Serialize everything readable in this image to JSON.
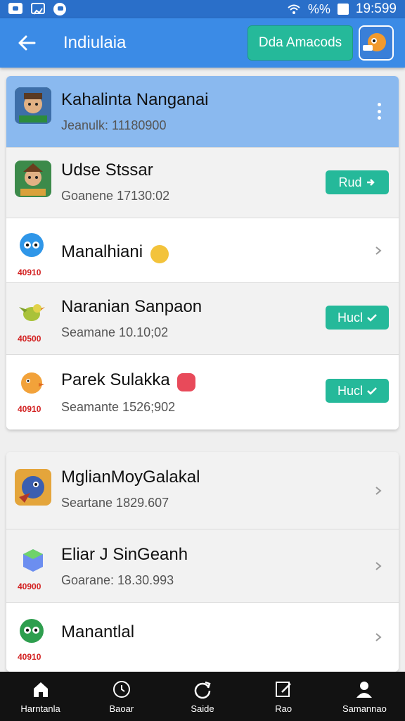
{
  "status_bar": {
    "time": "19:599",
    "signal": "%%"
  },
  "app_bar": {
    "title": "Indiulaia",
    "action_label": "Dda Amacods"
  },
  "list_top": [
    {
      "title": "Kahalinta Nanganai",
      "subtitle": "Jeanulk: 11180900",
      "trailing": "more"
    },
    {
      "title": "Udse Stssar",
      "subtitle": "Goanene 17130:02",
      "trailing": "pill",
      "pill_label": "Rud"
    },
    {
      "title": "Manalhiani",
      "badge": "40910",
      "trailing": "chevron"
    },
    {
      "title": "Naranian Sanpaon",
      "subtitle": "Seamane 10.10;02",
      "badge": "40500",
      "trailing": "pill",
      "pill_label": "Hucl"
    },
    {
      "title": "Parek Sulakka",
      "subtitle": "Seamante 1526;902",
      "badge": "40910",
      "trailing": "pill",
      "pill_label": "Hucl"
    }
  ],
  "list_bottom": [
    {
      "title": "MglianMoyGalakal",
      "subtitle": "Seartane 1829.607",
      "trailing": "chevron"
    },
    {
      "title": "Eliar J SinGeanh",
      "subtitle": "Goarane: 18.30.993",
      "badge": "40900",
      "trailing": "chevron"
    },
    {
      "title": "Manantlal",
      "badge": "40910",
      "trailing": "chevron"
    }
  ],
  "bottom_nav": [
    {
      "label": "Harntanla",
      "icon": "home-icon"
    },
    {
      "label": "Baoar",
      "icon": "clock-icon"
    },
    {
      "label": "Saide",
      "icon": "refresh-icon"
    },
    {
      "label": "Rao",
      "icon": "edit-icon"
    },
    {
      "label": "Samannao",
      "icon": "person-icon"
    }
  ],
  "colors": {
    "status_bar": "#2a6fc9",
    "app_bar": "#3b8be6",
    "accent_green": "#25b99a",
    "highlight_row": "#8ab9ef",
    "badge_red": "#d32222",
    "nav_bg": "#121212"
  }
}
